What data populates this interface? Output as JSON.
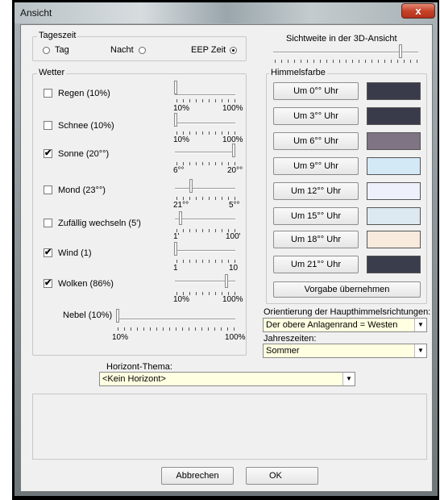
{
  "window": {
    "title": "Ansicht",
    "close_glyph": "x"
  },
  "tageszeit": {
    "legend": "Tageszeit",
    "options": [
      {
        "label": "Tag",
        "selected": false
      },
      {
        "label": "Nacht",
        "selected": false
      },
      {
        "label": "EEP Zeit",
        "selected": true
      }
    ]
  },
  "sichtweite": {
    "label": "Sichtweite in der 3D-Ansicht",
    "value_fraction": 0.88
  },
  "wetter": {
    "legend": "Wetter",
    "items": [
      {
        "label": "Regen (10%)",
        "checked": false,
        "min": "10%",
        "max": "100%",
        "value_fraction": 0.0
      },
      {
        "label": "Schnee (10%)",
        "checked": false,
        "min": "10%",
        "max": "100%",
        "value_fraction": 0.0
      },
      {
        "label": "Sonne (20°°)",
        "checked": true,
        "min": "6°°",
        "max": "20°°",
        "value_fraction": 1.0
      },
      {
        "label": "Mond (23°°)",
        "checked": false,
        "min": "21°°",
        "max": "5°°",
        "value_fraction": 0.25
      },
      {
        "label": "Zufällig wechseln (5')",
        "checked": false,
        "min": "1'",
        "max": "100'",
        "value_fraction": 0.05
      },
      {
        "label": "Wind (1)",
        "checked": true,
        "min": "1",
        "max": "10",
        "value_fraction": 0.0
      },
      {
        "label": "Wolken (86%)",
        "checked": true,
        "min": "10%",
        "max": "100%",
        "value_fraction": 0.85
      }
    ],
    "nebel": {
      "label": "Nebel (10%)",
      "min": "10%",
      "max": "100%",
      "value_fraction": 0.0
    }
  },
  "himmelsfarbe": {
    "legend": "Himmelsfarbe",
    "rows": [
      {
        "label": "Um 0°° Uhr",
        "color": "#3a3b4a"
      },
      {
        "label": "Um 3°° Uhr",
        "color": "#3a3b4a"
      },
      {
        "label": "Um 6°° Uhr",
        "color": "#7e7483"
      },
      {
        "label": "Um 9°° Uhr",
        "color": "#d4e9f6"
      },
      {
        "label": "Um 12°° Uhr",
        "color": "#eef0fb"
      },
      {
        "label": "Um 15°° Uhr",
        "color": "#dde9f1"
      },
      {
        "label": "Um 18°° Uhr",
        "color": "#f8eadc"
      },
      {
        "label": "Um 21°° Uhr",
        "color": "#3a3d4c"
      }
    ],
    "default_button": "Vorgabe übernehmen"
  },
  "orientierung": {
    "label": "Orientierung der Haupthimmelsrichtungen:",
    "value": "Der obere Anlagenrand = Westen"
  },
  "jahreszeiten": {
    "label": "Jahreszeiten:",
    "value": "Sommer"
  },
  "horizont": {
    "label": "Horizont-Thema:",
    "value": "<Kein Horizont>"
  },
  "buttons": {
    "cancel": "Abbrechen",
    "ok": "OK"
  }
}
